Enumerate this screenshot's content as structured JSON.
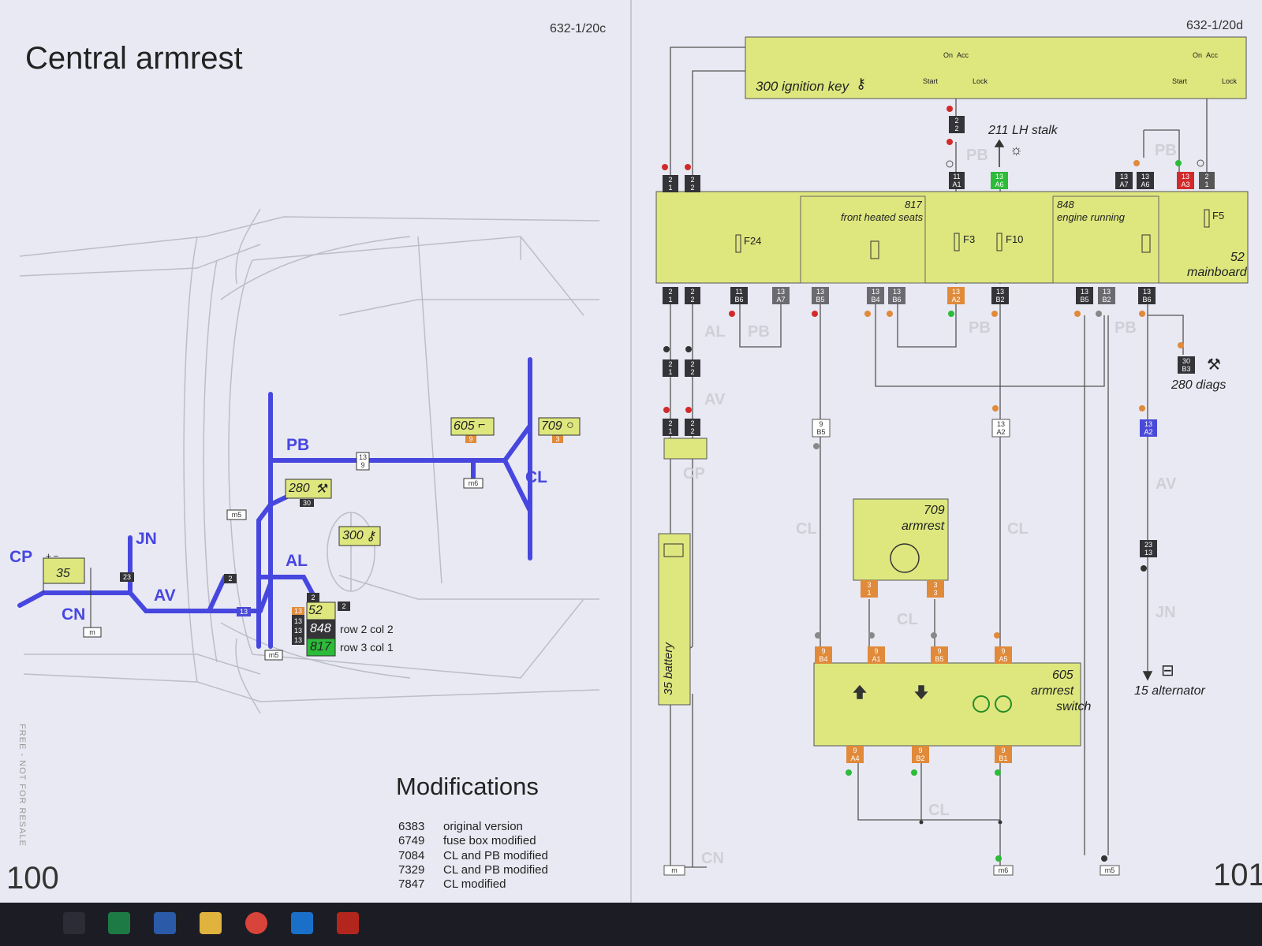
{
  "left_page": {
    "title": "Central armrest",
    "page_code": "632-1/20c",
    "page_number": "100",
    "side_note": "FREE - NOT FOR RESALE",
    "harness_labels": [
      "PB",
      "CL",
      "JN",
      "AV",
      "AL",
      "CP",
      "CN"
    ],
    "components": {
      "c605": "605",
      "c709": "709",
      "c280": "280",
      "c300": "300",
      "c35": "35",
      "c52": "52",
      "c848": "848",
      "c817": "817"
    },
    "small_labels": [
      "13/9",
      "m6",
      "m5",
      "m5",
      "m",
      "23",
      "2",
      "13",
      "2",
      "2",
      "9",
      "3",
      "30"
    ],
    "row_notes": [
      "row 2 col 2",
      "row 3 col 1"
    ],
    "modifications_title": "Modifications",
    "modifications": [
      {
        "id": "6383",
        "text": "original version"
      },
      {
        "id": "6749",
        "text": "fuse box modified"
      },
      {
        "id": "7084",
        "text": "CL and PB modified"
      },
      {
        "id": "7329",
        "text": "CL and PB modified"
      },
      {
        "id": "7847",
        "text": "CL modified"
      }
    ]
  },
  "right_page": {
    "page_code": "632-1/20d",
    "page_number": "101",
    "ignition_key": "300 ignition key",
    "ign_on": "On",
    "ign_acc": "Acc",
    "ign_start": "Start",
    "ign_lock": "Lock",
    "lh_stalk": "211 LH stalk",
    "front_heated_seats_num": "817",
    "front_heated_seats": "front heated seats",
    "engine_running_num": "848",
    "engine_running": "engine running",
    "mainboard_num": "52",
    "mainboard": "mainboard",
    "fuses": [
      "F24",
      "F3",
      "F10",
      "F5"
    ],
    "diags": "280 diags",
    "armrest_num": "709",
    "armrest": "armrest",
    "switch_num": "605",
    "switch_l1": "armrest",
    "switch_l2": "switch",
    "battery": "35 battery",
    "alternator": "15 alternator",
    "harness_watermarks": [
      "PB",
      "PB",
      "PB",
      "PB",
      "AL",
      "PB",
      "AV",
      "CP",
      "CL",
      "CL",
      "CL",
      "CL",
      "AV",
      "JN",
      "CN"
    ],
    "top_connectors": [
      "2/1",
      "2/2",
      "2/2",
      "11/A1",
      "13/A6",
      "13/A7",
      "13/A6",
      "13/A3",
      "2/1"
    ],
    "bottom_connectors": [
      "2/1",
      "2/2",
      "11/B6",
      "13/A7",
      "13/B5",
      "13/B4",
      "13/B6",
      "13/A2",
      "13/B2",
      "13/B5",
      "13/B2",
      "13/B6"
    ],
    "mid_connectors": [
      "2/1",
      "2/2",
      "2/1",
      "2/2",
      "9/B5",
      "13/A2",
      "13/A2",
      "23/13",
      "30/B3"
    ],
    "switch_pins_top": [
      "9/B4",
      "9/A1",
      "9/B5",
      "9/A5"
    ],
    "switch_pins_bottom": [
      "9/A4",
      "9/B2",
      "9/B1"
    ],
    "armrest_pins": [
      "3/1",
      "3/3"
    ],
    "grounds": [
      "m",
      "m6",
      "m5"
    ]
  },
  "taskbar": {
    "icons": [
      "task-view-icon",
      "excel-icon",
      "word-icon",
      "file-explorer-icon",
      "chrome-icon",
      "outlook-icon",
      "acrobat-icon"
    ]
  },
  "colors": {
    "harness_blue": "#4747e0",
    "module_yellow": "#dde77e",
    "connector_dark": "#333338",
    "connector_orange": "#e08a3a",
    "connector_green": "#2dbb3a",
    "connector_red": "#d22a2a",
    "connector_blue": "#4a4ad8",
    "page_bg": "#e9e9f3"
  }
}
